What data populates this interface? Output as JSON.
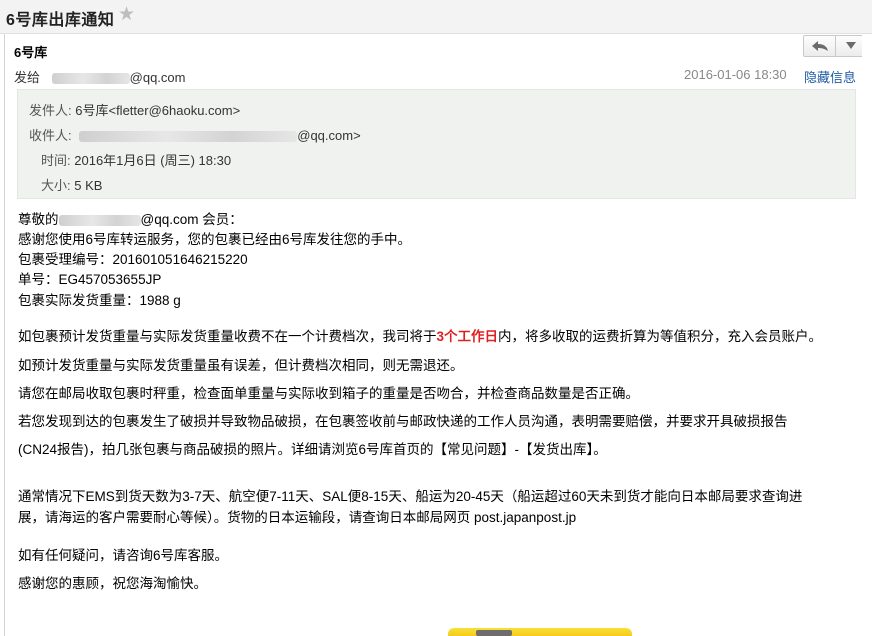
{
  "title": "6号库出库通知",
  "header": {
    "sender_name": "6号库",
    "to_label": "发给",
    "to_address_suffix": "@qq.com",
    "date": "2016-01-06 18:30",
    "hide_info": "隐藏信息"
  },
  "info": {
    "from_label": "发件人:",
    "from_value": "6号库<fletter@6haoku.com>",
    "to_label": "收件人:",
    "to_value_suffix": "@qq.com>",
    "time_label": "时间:",
    "time_value": "2016年1月6日 (周三) 18:30",
    "size_label": "大小:",
    "size_value": "5 KB"
  },
  "body": {
    "greeting_prefix": "尊敬的",
    "greeting_suffix": "@qq.com 会员：",
    "line1": "感谢您使用6号库转运服务，您的包裹已经由6号库发往您的手中。",
    "line2": "包裹受理编号：201601051646215220",
    "line3": "单号：EG457053655JP",
    "line4": "包裹实际发货重量：1988 g",
    "p1_before": "如包裹预计发货重量与实际发货重量收费不在一个计费档次，我司将于",
    "p1_highlight": "3个工作日",
    "p1_after": "内，将多收取的运费折算为等值积分，充入会员账户。",
    "p2": "如预计发货重量与实际发货重量虽有误差，但计费档次相同，则无需退还。",
    "p3": "请您在邮局收取包裹时秤重，检查面单重量与实际收到箱子的重量是否吻合，并检查商品数量是否正确。",
    "p4_line1": "若您发现到达的包裹发生了破损并导致物品破损，在包裹签收前与邮政快递的工作人员沟通，表明需要赔偿，并要求开具破损报告",
    "p4_line2": "(CN24报告)，拍几张包裹与商品破损的照片。详细请浏览6号库首页的【常见问题】-【发货出库】。",
    "p5_line1": "通常情况下EMS到货天数为3-7天、航空便7-11天、SAL便8-15天、船运为20-45天（船运超过60天未到货才能向日本邮局要求查询进",
    "p5_line2": "展，请海运的客户需要耐心等候）。货物的日本运输段，请查询日本邮局网页 post.japanpost.jp",
    "p6": "如有任何疑问，请咨询6号库客服。",
    "p7": "感谢您的惠顾，祝您海淘愉快。"
  },
  "icons": {
    "star": "star-icon",
    "reply": "reply-icon",
    "menu": "chevron-down-icon"
  },
  "colors": {
    "highlight": "#e02020",
    "link": "#1d5aa3",
    "info_bg": "#f0f2f0"
  }
}
